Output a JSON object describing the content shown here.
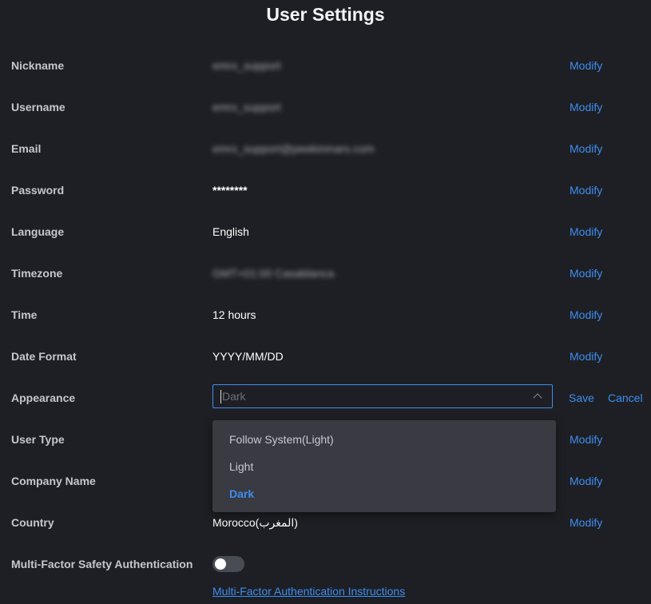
{
  "title": "User Settings",
  "modify_label": "Modify",
  "rows": {
    "nickname": {
      "label": "Nickname",
      "value": "emrx_support"
    },
    "username": {
      "label": "Username",
      "value": "emrx_support"
    },
    "email": {
      "label": "Email",
      "value": "emrx_support@peekinmars.com"
    },
    "password": {
      "label": "Password",
      "value": "********"
    },
    "language": {
      "label": "Language",
      "value": "English"
    },
    "timezone": {
      "label": "Timezone",
      "value": "GMT+01:00 Casablanca"
    },
    "time": {
      "label": "Time",
      "value": "12 hours"
    },
    "date_format": {
      "label": "Date Format",
      "value": "YYYY/MM/DD"
    },
    "appearance": {
      "label": "Appearance",
      "value": "Dark",
      "save_label": "Save",
      "cancel_label": "Cancel"
    },
    "user_type": {
      "label": "User Type"
    },
    "company_name": {
      "label": "Company Name"
    },
    "country": {
      "label": "Country",
      "value": "Morocco(المغرب)"
    },
    "mfa": {
      "label": "Multi-Factor Safety Authentication",
      "enabled": false
    }
  },
  "appearance_options": [
    "Follow System(Light)",
    "Light",
    "Dark"
  ],
  "mfa_instructions_link": "Multi-Factor Authentication Instructions",
  "colors": {
    "background": "#1e1f24",
    "accent": "#3d8ef0",
    "dropdown_bg": "#393a42"
  }
}
